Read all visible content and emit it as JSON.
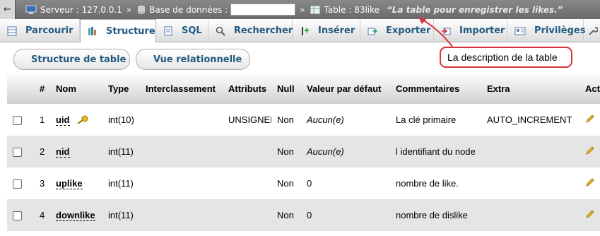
{
  "breadcrumb": {
    "toggle": "←",
    "server_label": "Serveur : 127.0.0.1",
    "sep": "»",
    "db_label": "Base de données :",
    "table_label": "Table : 83like",
    "table_comment": "“La table pour enregistrer les likes.”"
  },
  "tabs": [
    {
      "label": "Parcourir",
      "icon": "browse-icon"
    },
    {
      "label": "Structure",
      "icon": "structure-icon"
    },
    {
      "label": "SQL",
      "icon": "sql-icon"
    },
    {
      "label": "Rechercher",
      "icon": "search-icon"
    },
    {
      "label": "Insérer",
      "icon": "insert-icon"
    },
    {
      "label": "Exporter",
      "icon": "export-icon"
    },
    {
      "label": "Importer",
      "icon": "import-icon"
    },
    {
      "label": "Privilèges",
      "icon": "privileges-icon"
    }
  ],
  "subtabs": {
    "structure": "Structure de table",
    "relational": "Vue relationnelle"
  },
  "callout": "La description de la table",
  "table": {
    "headers": [
      "#",
      "Nom",
      "Type",
      "Interclassement",
      "Attributs",
      "Null",
      "Valeur par défaut",
      "Commentaires",
      "Extra",
      "Action"
    ],
    "rows": [
      {
        "num": "1",
        "name": "uid",
        "type": "int(10)",
        "collation": "",
        "attributes": "UNSIGNED",
        "null": "Non",
        "default": "Aucun(e)",
        "comment": "La clé primaire",
        "extra": "AUTO_INCREMENT"
      },
      {
        "num": "2",
        "name": "nid",
        "type": "int(11)",
        "collation": "",
        "attributes": "",
        "null": "Non",
        "default": "Aucun(e)",
        "comment": "l identifiant du node",
        "extra": ""
      },
      {
        "num": "3",
        "name": "uplike",
        "type": "int(11)",
        "collation": "",
        "attributes": "",
        "null": "Non",
        "default": "0",
        "comment": "nombre de like.",
        "extra": ""
      },
      {
        "num": "4",
        "name": "downlike",
        "type": "int(11)",
        "collation": "",
        "attributes": "",
        "null": "Non",
        "default": "0",
        "comment": "nombre de dislike",
        "extra": ""
      }
    ]
  }
}
